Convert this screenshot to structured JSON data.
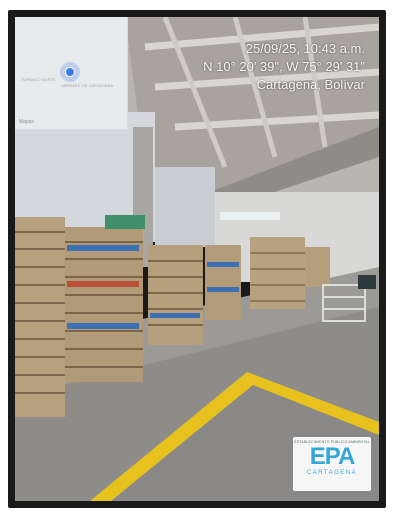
{
  "photo": {
    "date_time": "25/09/25, 10:43 a.m.",
    "coordinates": "N 10° 20' 39\", W 75° 29' 31\"",
    "location": "Cartagena, Bolívar"
  },
  "minimap": {
    "street_1": "TURBACO NORTE",
    "street_2": "VARIANTE DE CARTAGENA",
    "attribution": "Mapas"
  },
  "logo": {
    "tagline": "ESTABLECIMIENTO PÚBLICO AMBIENTAL",
    "name": "EPA",
    "city": "CARTAGENA"
  },
  "colors": {
    "floor_line": "#e7c21f",
    "logo_blue": "#35a6d6",
    "logo_green": "#6ab545"
  }
}
